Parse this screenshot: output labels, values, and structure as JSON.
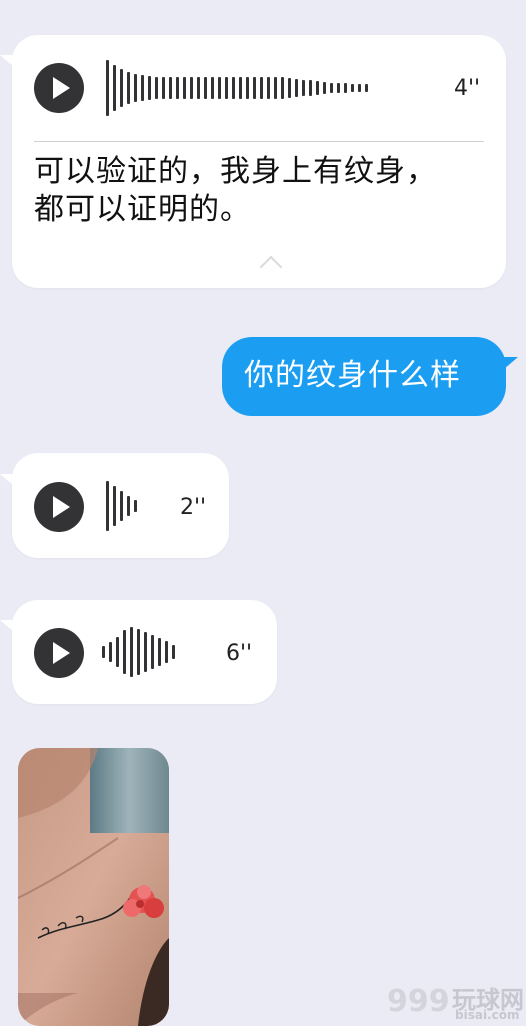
{
  "messages": [
    {
      "id": "voice-1",
      "from": "them",
      "type": "voice",
      "duration": "4''",
      "transcript": [
        "可以验证的，我身上有纹身，",
        "都可以证明的。"
      ]
    },
    {
      "id": "text-1",
      "from": "me",
      "type": "text",
      "text": "你的纹身什么样"
    },
    {
      "id": "voice-2",
      "from": "them",
      "type": "voice",
      "duration": "2''"
    },
    {
      "id": "voice-3",
      "from": "them",
      "type": "voice",
      "duration": "6''"
    },
    {
      "id": "photo-1",
      "from": "them",
      "type": "image",
      "image": "tattoo-shoulder-photo"
    }
  ],
  "watermark": {
    "cn": "玩球网",
    "en": "bisai.com",
    "num": "999"
  },
  "colors": {
    "background": "#ebebf5",
    "outgoing": "#1b9ef2",
    "incoming": "#ffffff",
    "icon": "#333336"
  }
}
